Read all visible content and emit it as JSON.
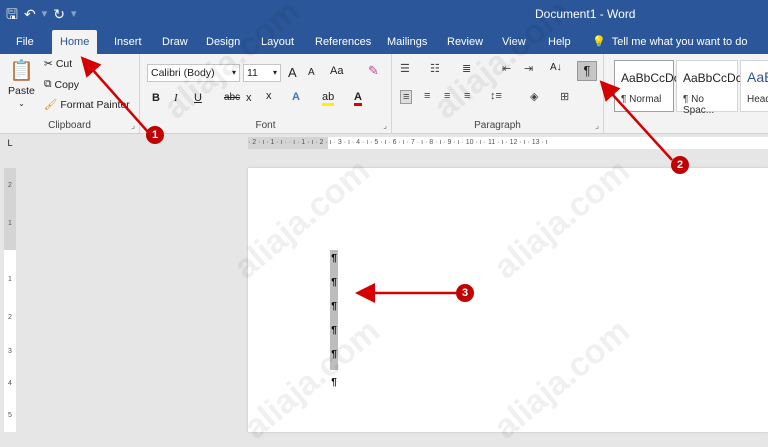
{
  "title_bar": {
    "save_icon": "save-icon",
    "undo_icon": "undo-icon",
    "redo_icon": "redo-icon",
    "document_title": "Document1 - Word"
  },
  "tabs": [
    "File",
    "Home",
    "Insert",
    "Draw",
    "Design",
    "Layout",
    "References",
    "Mailings",
    "Review",
    "View",
    "Help"
  ],
  "tell_me": "Tell me what you want to do",
  "clipboard": {
    "paste": "Paste",
    "cut": "Cut",
    "copy": "Copy",
    "format_painter": "Format Painter",
    "label": "Clipboard"
  },
  "font": {
    "font_name": "Calibri (Body)",
    "font_size": "11",
    "grow": "A",
    "shrink": "A",
    "change_case": "Aa",
    "bold": "B",
    "italic": "I",
    "underline": "U",
    "strikethrough": "abc",
    "subscript": "x",
    "superscript": "x",
    "text_effects": "A",
    "font_color": "A",
    "label": "Font"
  },
  "paragraph": {
    "show_hide": "¶",
    "sort": "A↓",
    "label": "Paragraph"
  },
  "styles": [
    {
      "sample": "AaBbCcDc",
      "name": "¶ Normal"
    },
    {
      "sample": "AaBbCcDc",
      "name": "¶ No Spac..."
    },
    {
      "sample": "AaB",
      "name": "Head"
    }
  ],
  "ruler_text": "· 2 · ı · 1 · ı ·   · ı · 1 · ı · 2 · ı · 3 · ı · 4 · ı · 5 · ı · 6 · ı · 7 · ı · 8 · ı · 9 · ı · 10 · ı · 11 · ı · 12 · ı · 13 · ı",
  "vruler_numbers": [
    "2",
    "1",
    "1",
    "2",
    "3",
    "4",
    "5"
  ],
  "pilcrows": [
    "¶",
    "¶",
    "¶",
    "¶",
    "¶",
    "¶"
  ],
  "callouts": [
    "1",
    "2",
    "3"
  ],
  "watermark": "aliaja.com",
  "colors": {
    "accent": "#2b579a",
    "callout": "#c00000"
  }
}
